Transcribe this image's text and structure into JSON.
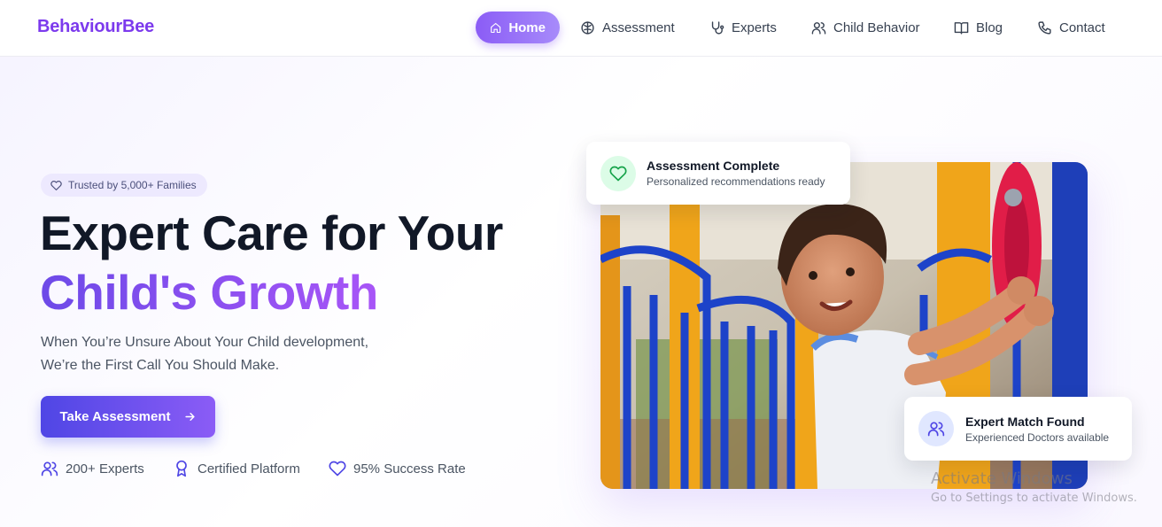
{
  "brand": "BehaviourBee",
  "nav": {
    "items": [
      {
        "label": "Home",
        "icon": "home-icon",
        "active": true
      },
      {
        "label": "Assessment",
        "icon": "brain-icon",
        "active": false
      },
      {
        "label": "Experts",
        "icon": "stethoscope-icon",
        "active": false
      },
      {
        "label": "Child Behavior",
        "icon": "users-icon",
        "active": false
      },
      {
        "label": "Blog",
        "icon": "book-open-icon",
        "active": false
      },
      {
        "label": "Contact",
        "icon": "phone-icon",
        "active": false
      }
    ]
  },
  "hero": {
    "badge": "Trusted by 5,000+ Families",
    "title_line1": "Expert Care for Your",
    "title_line2": "Child's Growth",
    "subtitle_line1": "When You’re Unsure About Your Child development,",
    "subtitle_line2": "We’re the First Call You Should Make.",
    "cta_label": "Take Assessment",
    "stats": [
      {
        "label": "200+ Experts",
        "icon": "users-icon"
      },
      {
        "label": "Certified Platform",
        "icon": "award-icon"
      },
      {
        "label": "95% Success Rate",
        "icon": "heart-icon"
      }
    ]
  },
  "cards": {
    "assessment": {
      "title": "Assessment Complete",
      "desc": "Personalized recommendations ready",
      "icon": "heart-icon"
    },
    "expert": {
      "title": "Expert Match Found",
      "desc": "Experienced Doctors available",
      "icon": "users-icon"
    }
  },
  "watermark": {
    "line1": "Activate Windows",
    "line2": "Go to Settings to activate Windows."
  },
  "colors": {
    "brand": "#7c3aed",
    "accent": "#8b5cf6",
    "cta": "#4f46e5"
  }
}
